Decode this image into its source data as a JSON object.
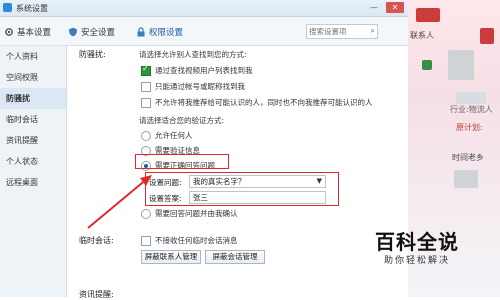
{
  "window": {
    "title": "系统设置",
    "btn_min": "—",
    "btn_close": "✕"
  },
  "toolbar": {
    "tabs": [
      {
        "label": "基本设置"
      },
      {
        "label": "安全设置"
      },
      {
        "label": "权限设置"
      }
    ],
    "search_placeholder": "搜索设置项"
  },
  "sidebar": {
    "items": [
      {
        "label": "个人资料"
      },
      {
        "label": "空间权限"
      },
      {
        "label": "防骚扰"
      },
      {
        "label": "临时会话"
      },
      {
        "label": "资讯提醒"
      },
      {
        "label": "个人状态"
      },
      {
        "label": "远程桌面"
      }
    ]
  },
  "main": {
    "section1_label": "防骚扰:",
    "find_heading": "请选择允许别人查找到您的方式:",
    "find_options": [
      {
        "label": "通过查找视频用户列表找到我",
        "checked": true
      },
      {
        "label": "只能通过帐号或昵称找到我",
        "checked": false
      },
      {
        "label": "不允许将我推荐给可能认识的人，同时也不向我推荐可能认识的人",
        "checked": false
      }
    ],
    "verify_heading": "请选择适合您的验证方式:",
    "verify_options": [
      {
        "label": "允许任何人"
      },
      {
        "label": "需要验证信息"
      },
      {
        "label": "需要正确回答问题"
      }
    ],
    "question_label": "设置问题:",
    "question_value": "我的真实名字？",
    "answer_label": "设置答案:",
    "answer_value": "张三",
    "last_option": "需要回答问题并由我确认",
    "section2_label": "临时会话:",
    "temp_option": "不接收任何临时会话消息",
    "btn_block_contacts": "屏蔽联系人管理",
    "btn_block_sessions": "屏蔽会话管理",
    "section3_label": "资讯提醒:"
  },
  "right": {
    "text1": "联系人",
    "text2": "行业:物流人",
    "text3": "原计划:",
    "text4": "时间老乡"
  },
  "watermark": {
    "title": "百科全说",
    "subtitle": "助你轻松解决"
  },
  "colors": {
    "accent": "#1a5aa6",
    "highlight": "#e02a2a",
    "check": "#2a9a39"
  }
}
